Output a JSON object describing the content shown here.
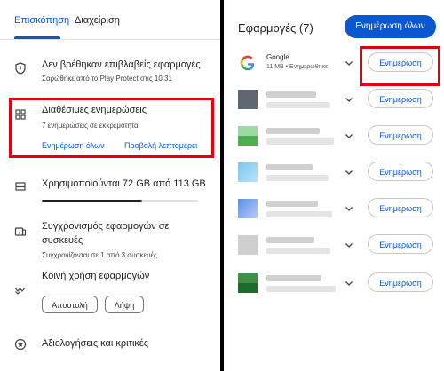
{
  "left": {
    "tabs": {
      "overview": "Επισκόπηση",
      "manage": "Διαχείριση"
    },
    "protect": {
      "title": "Δεν βρέθηκαν επιβλαβείς εφαρμογές",
      "subtitle": "Σαρώθηκε από το Play Protect στις 10:31"
    },
    "updates": {
      "title": "Διαθέσιμες ενημερώσεις",
      "subtitle": "7 ενημερώσεις σε εκκρεμότητα",
      "update_all": "Ενημέρωση όλων",
      "details": "Προβολή λεπτομερει"
    },
    "storage": {
      "title": "Χρησιμοποιούνται 72 GB από 113 GB",
      "used_fraction": 0.64
    },
    "sync": {
      "title_line1": "Συγχρονισμός εφαρμογών σε",
      "title_line2": "συσκευές",
      "subtitle": "Συγχρονίζονται σε 1 από 3 συσκευές"
    },
    "share": {
      "title": "Κοινή χρήση εφαρμογών",
      "send": "Αποστολή",
      "receive": "Λήψη"
    },
    "ratings": {
      "title": "Αξιολογήσεις και κριτικές"
    }
  },
  "right": {
    "title": "Εφαρμογές (7)",
    "update_all": "Ενημέρωση όλων",
    "update_label": "Ενημέρωση",
    "google_app": {
      "name": "Google",
      "meta": "11 MB • Ενημερώθηκε"
    }
  },
  "colors": {
    "accent": "#0b57d0",
    "highlight": "#e0000f"
  }
}
